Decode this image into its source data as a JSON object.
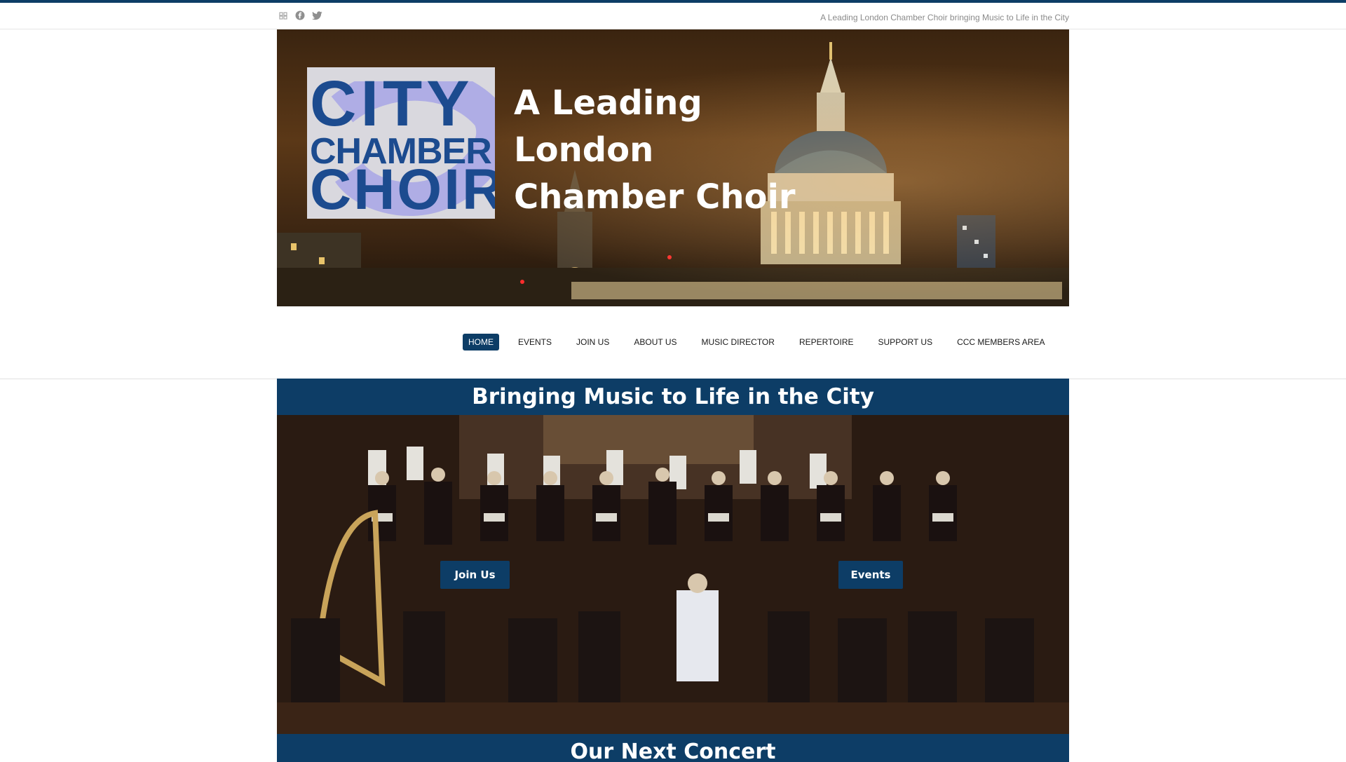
{
  "topbar": {
    "tagline": "A Leading London Chamber Choir bringing Music to Life in the City",
    "social_icons": [
      "grid-icon",
      "facebook-icon",
      "twitter-icon"
    ]
  },
  "banner": {
    "logo_text": [
      "CITY",
      "CHAMBER",
      "CHOIR"
    ],
    "headline_line1": "A Leading London",
    "headline_line2": "Chamber Choir"
  },
  "nav": {
    "items": [
      {
        "label": "HOME",
        "active": true
      },
      {
        "label": "EVENTS"
      },
      {
        "label": "JOIN US"
      },
      {
        "label": "ABOUT US"
      },
      {
        "label": "MUSIC DIRECTOR"
      },
      {
        "label": "REPERTOIRE"
      },
      {
        "label": "SUPPORT US"
      },
      {
        "label": "CCC MEMBERS AREA"
      }
    ]
  },
  "hero": {
    "title": "Bringing Music to Life in the City",
    "join_button": "Join Us",
    "events_button": "Events"
  },
  "next_concert": {
    "title": "Our Next Concert"
  },
  "colors": {
    "brand": "#0d3d66",
    "logo_blue": "#1c4b8f"
  }
}
